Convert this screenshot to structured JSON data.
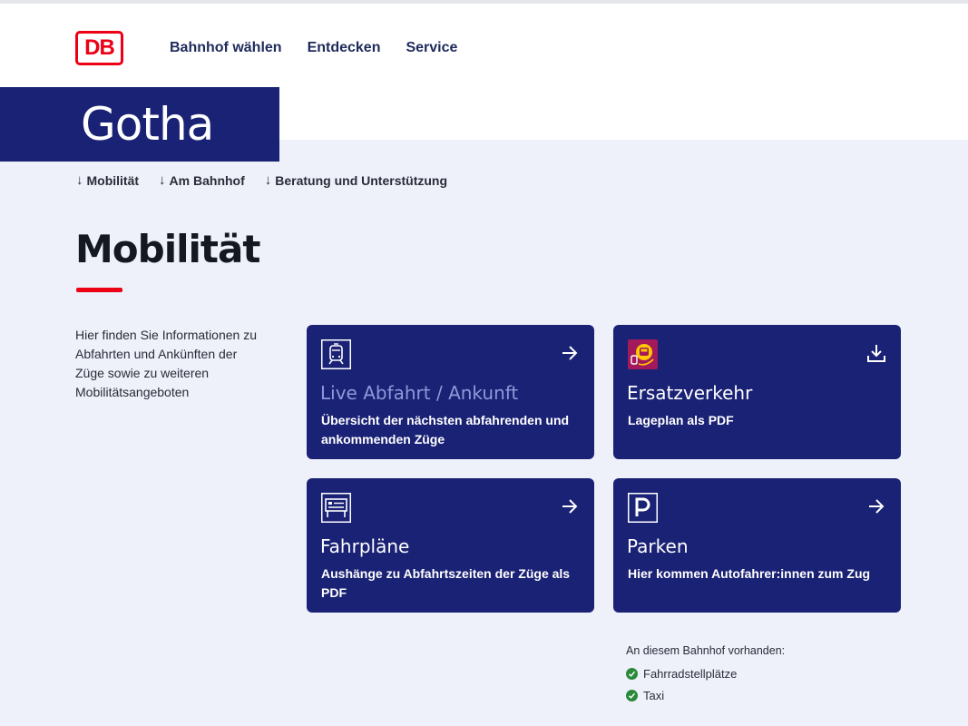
{
  "header": {
    "logo_text": "DB",
    "nav": [
      "Bahnhof wählen",
      "Entdecken",
      "Service"
    ]
  },
  "station": {
    "name": "Gotha"
  },
  "anchors": [
    "Mobilität",
    "Am Bahnhof",
    "Beratung und Unterstützung"
  ],
  "section": {
    "title": "Mobilität",
    "intro": "Hier finden Sie Informationen zu Abfahrten und Ankünften der Züge sowie zu weiteren Mobilitätsangeboten"
  },
  "cards": [
    {
      "title": "Live Abfahrt / Ankunft",
      "desc": "Übersicht der nächsten abfahrenden und ankommenden Züge",
      "icon": "train-icon",
      "action": "arrow-right-icon"
    },
    {
      "title": "Ersatzverkehr",
      "desc": "Lageplan als PDF",
      "icon": "replacement-bus-icon",
      "action": "download-icon"
    },
    {
      "title": "Fahrpläne",
      "desc": "Aushänge zu Abfahrtszeiten der Züge als PDF",
      "icon": "timetable-board-icon",
      "action": "arrow-right-icon"
    },
    {
      "title": "Parken",
      "desc": "Hier kommen Autofahrer:innen zum Zug",
      "icon": "parking-icon",
      "action": "arrow-right-icon"
    }
  ],
  "availability": {
    "heading": "An diesem Bahnhof vorhanden:",
    "items": [
      "Fahrradstellplätze",
      "Taxi"
    ]
  },
  "colors": {
    "brand_red": "#ec0016",
    "navy": "#1a2275",
    "page_bg": "#eef0fa",
    "check_green": "#2a8a3a"
  }
}
